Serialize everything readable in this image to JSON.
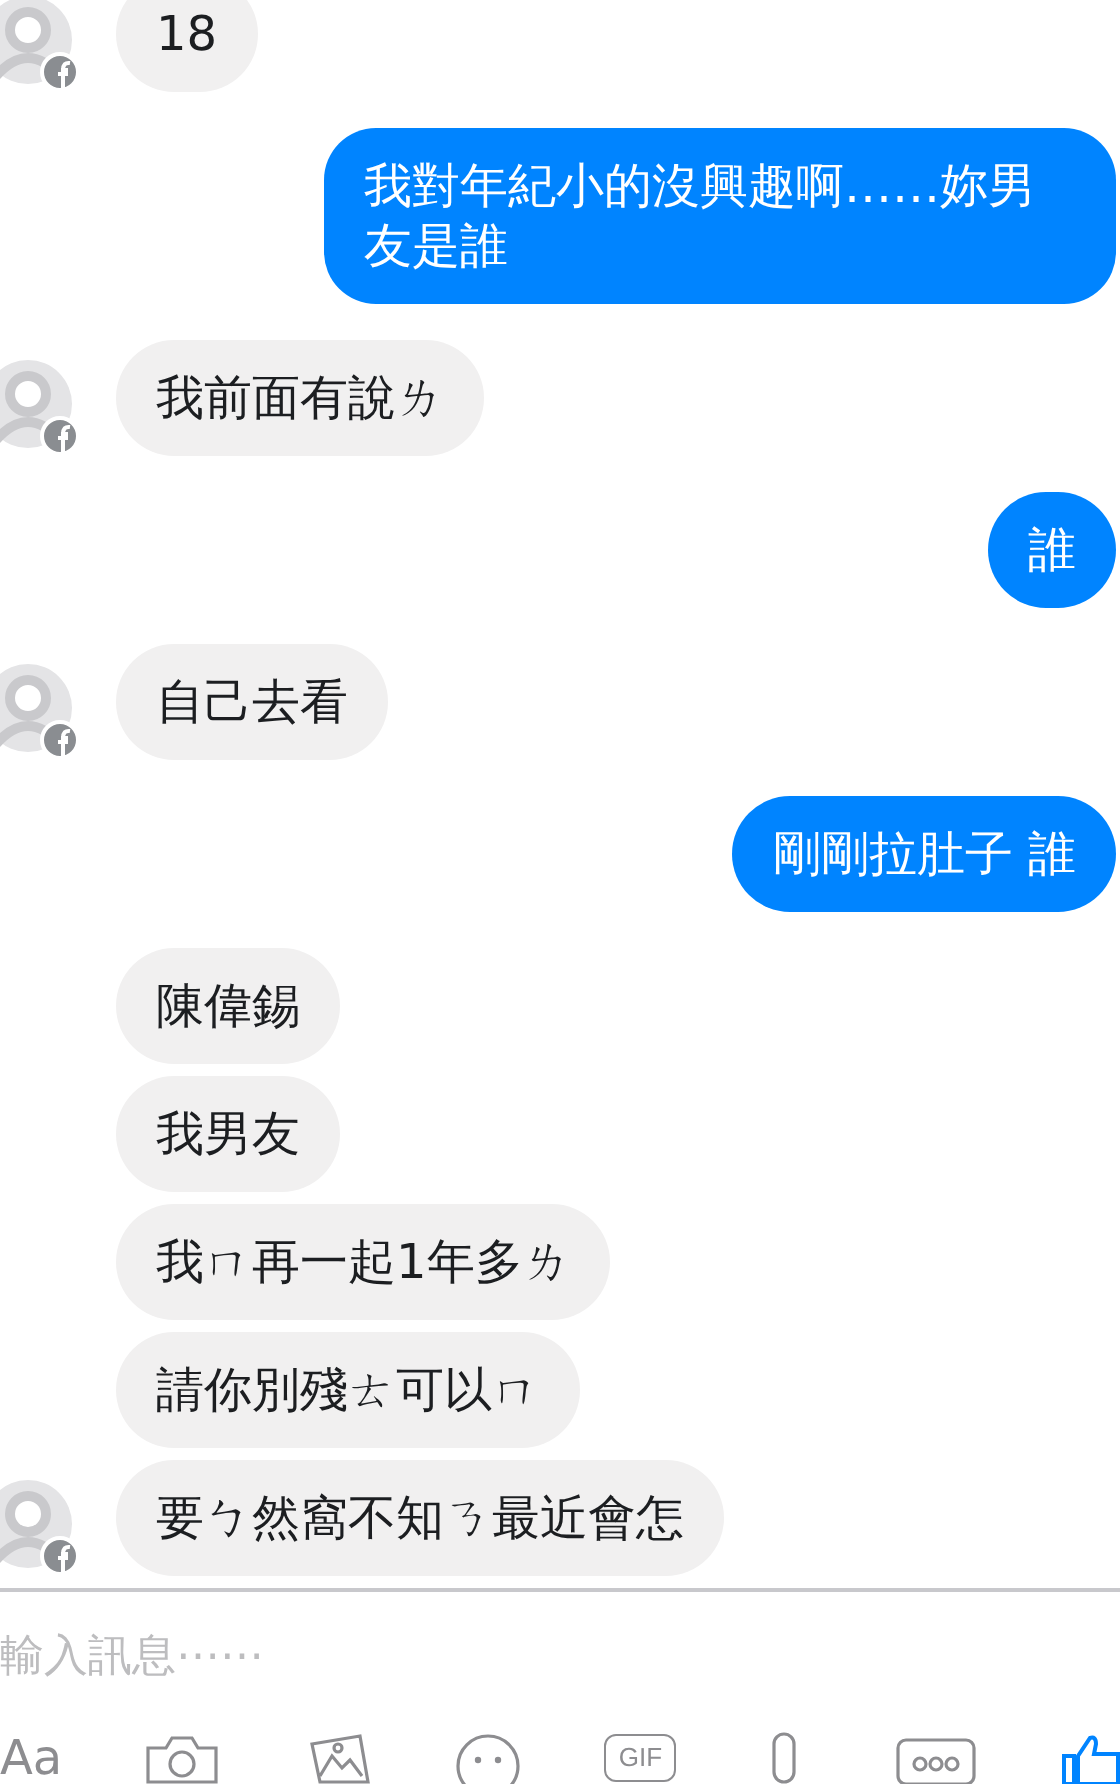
{
  "messages": [
    {
      "kind": "received",
      "text": "18",
      "avatar": true
    },
    {
      "kind": "sent",
      "text": "我對年紀小的沒興趣啊……妳男友是誰"
    },
    {
      "kind": "received",
      "text": "我前面有說ㄌ",
      "avatar": true
    },
    {
      "kind": "sent",
      "text": "誰"
    },
    {
      "kind": "received",
      "text": "自己去看",
      "avatar": true
    },
    {
      "kind": "sent",
      "text": "剛剛拉肚子 誰"
    },
    {
      "kind": "received",
      "text": "陳偉錫",
      "avatar": false
    },
    {
      "kind": "received",
      "text": "我男友",
      "avatar": false
    },
    {
      "kind": "received",
      "text": "我ㄇ再一起1年多ㄌ",
      "avatar": false
    },
    {
      "kind": "received",
      "text": "請你別殘ㄊ可以ㄇ",
      "avatar": false
    },
    {
      "kind": "received",
      "text": "要ㄅ然窩不知ㄋ最近會怎",
      "avatar": true
    }
  ],
  "composer": {
    "placeholder": "輸入訊息⋯⋯",
    "text_button": "Aa",
    "gif_button": "GIF"
  }
}
